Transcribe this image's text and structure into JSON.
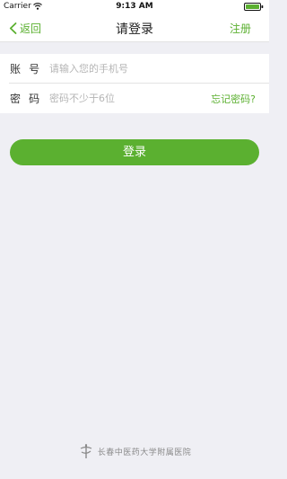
{
  "status_bar": {
    "carrier": "Carrier",
    "time": "9:13 AM"
  },
  "nav": {
    "back_label": "返回",
    "title": "请登录",
    "register_label": "注册"
  },
  "form": {
    "account": {
      "label": "账  号",
      "placeholder": "请输入您的手机号"
    },
    "password": {
      "label": "密  码",
      "placeholder": "密码不少于6位",
      "forgot_label": "忘记密码?"
    }
  },
  "login_button": {
    "label": "登录"
  },
  "footer": {
    "text": "长春中医药大学附属医院"
  },
  "colors": {
    "accent": "#5bb030",
    "background": "#efeff4"
  }
}
